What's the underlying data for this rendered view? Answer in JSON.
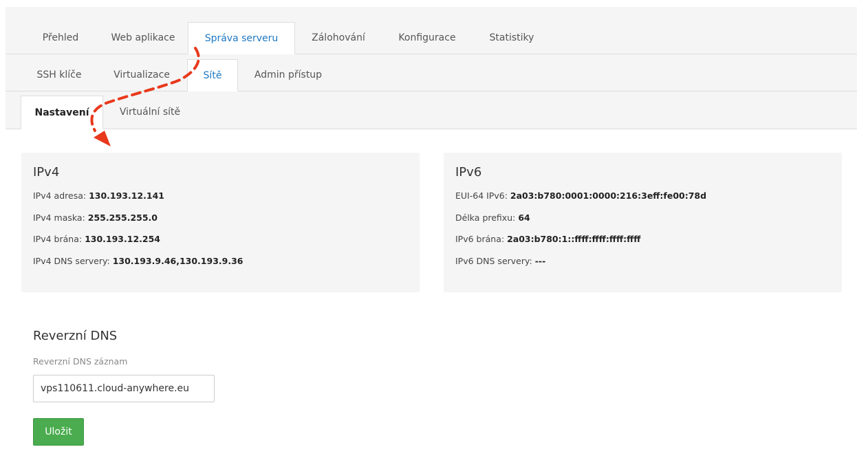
{
  "main_tabs": [
    {
      "label": "Přehled"
    },
    {
      "label": "Web aplikace"
    },
    {
      "label": "Správa serveru",
      "active": true
    },
    {
      "label": "Zálohování"
    },
    {
      "label": "Konfigurace"
    },
    {
      "label": "Statistiky"
    }
  ],
  "sub_tabs": [
    {
      "label": "SSH klíče"
    },
    {
      "label": "Virtualizace"
    },
    {
      "label": "Sítě",
      "active": true
    },
    {
      "label": "Admin přístup"
    }
  ],
  "section_tabs": [
    {
      "label": "Nastavení",
      "active": true
    },
    {
      "label": "Virtuální sítě"
    }
  ],
  "ipv4": {
    "title": "IPv4",
    "rows": [
      {
        "label": "IPv4 adresa: ",
        "value": "130.193.12.141"
      },
      {
        "label": "IPv4 maska: ",
        "value": "255.255.255.0"
      },
      {
        "label": "IPv4 brána: ",
        "value": "130.193.12.254"
      },
      {
        "label": "IPv4 DNS servery: ",
        "value": "130.193.9.46,130.193.9.36"
      }
    ]
  },
  "ipv6": {
    "title": "IPv6",
    "rows": [
      {
        "label": "EUI-64 IPv6: ",
        "value": "2a03:b780:0001:0000:216:3eff:fe00:78d"
      },
      {
        "label": "Délka prefixu: ",
        "value": "64"
      },
      {
        "label": "IPv6 brána: ",
        "value": "2a03:b780:1::ffff:ffff:ffff:ffff"
      },
      {
        "label": "IPv6 DNS servery: ",
        "value": "---"
      }
    ]
  },
  "reverse_dns": {
    "title": "Reverzní DNS",
    "field_label": "Reverzní DNS záznam",
    "value": "vps110611.cloud-anywhere.eu",
    "save_label": "Uložit"
  },
  "colors": {
    "accent": "#1e78c2",
    "save": "#4aac4e",
    "arrow": "#e8391c"
  }
}
